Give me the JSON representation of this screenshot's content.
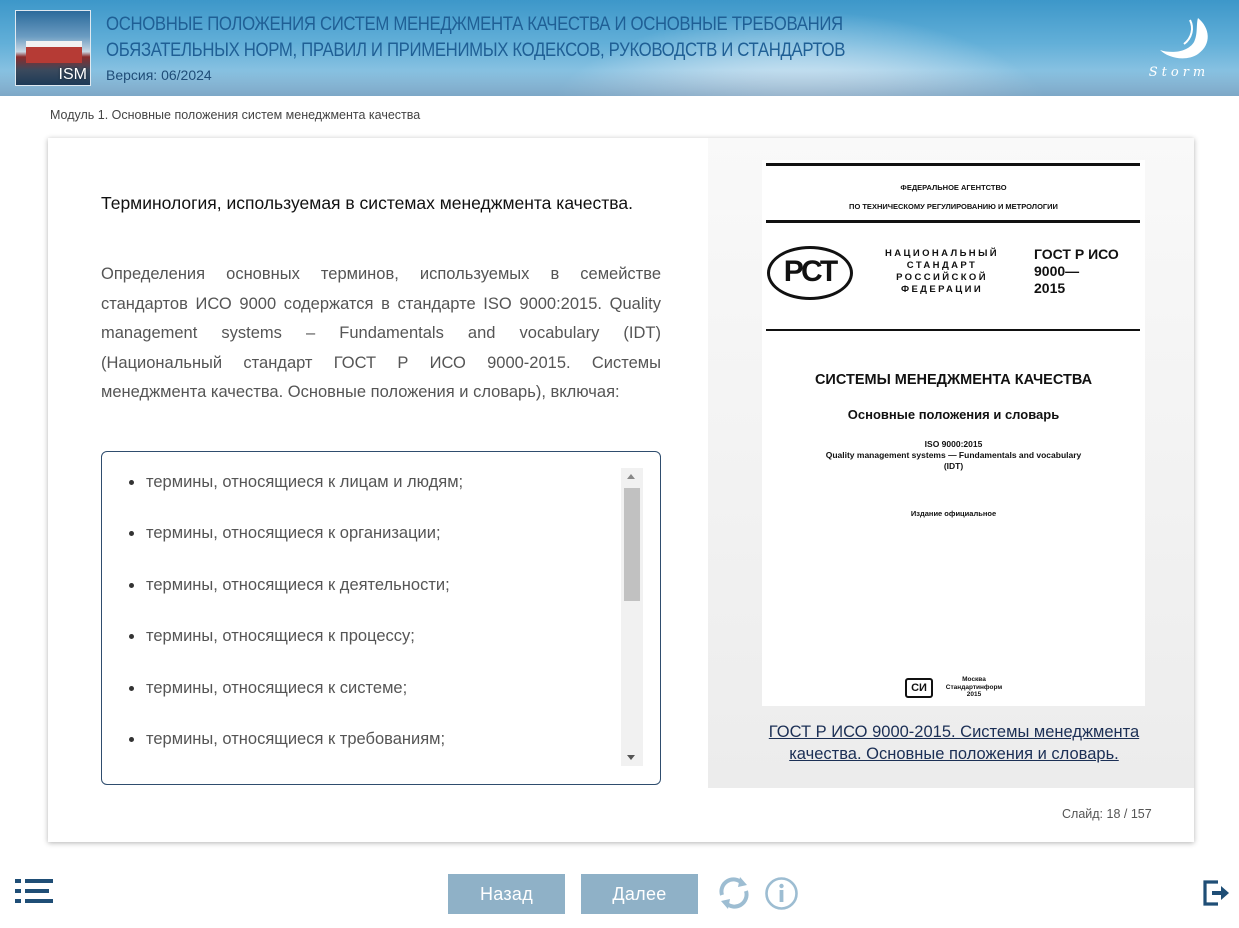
{
  "header": {
    "title_line1": "ОСНОВНЫЕ ПОЛОЖЕНИЯ СИСТЕМ МЕНЕДЖМЕНТА КАЧЕСТВА И ОСНОВНЫЕ ТРЕБОВАНИЯ",
    "title_line2": "ОБЯЗАТЕЛЬНЫХ НОРМ, ПРАВИЛ И ПРИМЕНИМЫХ КОДЕКСОВ, РУКОВОДСТВ И СТАНДАРТОВ",
    "version": "Версия: 06/2024",
    "logo_text": "ISM",
    "brand": "Storm"
  },
  "breadcrumb": "Модуль 1. Основные положения систем менеджмента качества",
  "content": {
    "heading": "Терминология, используемая в системах менеджмента качества.",
    "body": "Определения основных терминов, используемых в семействе стандартов ИСО 9000 содержатся в стандарте ISO 9000:2015. Quality management systems – Fundamentals and vocabulary (IDT) (Национальный стандарт ГОСТ Р ИСО 9000-2015. Системы менеджмента качества. Основные положения и словарь), включая:",
    "list": [
      "термины, относящиеся к лицам и людям;",
      "термины, относящиеся к организации;",
      "термины, относящиеся к деятельности;",
      "термины, относящиеся к процессу;",
      "термины, относящиеся к системе;",
      "термины, относящиеся к требованиям;"
    ]
  },
  "document": {
    "agency_line1": "ФЕДЕРАЛЬНОЕ АГЕНТСТВО",
    "agency_line2": "ПО ТЕХНИЧЕСКОМУ РЕГУЛИРОВАНИЮ И МЕТРОЛОГИИ",
    "logo_text": "РСТ",
    "national_standard": "НАЦИОНАЛЬНЫЙ СТАНДАРТ РОССИЙСКОЙ ФЕДЕРАЦИИ",
    "number_line1": "ГОСТ Р ИСО",
    "number_line2": "9000—",
    "number_line3": "2015",
    "title": "СИСТЕМЫ МЕНЕДЖМЕНТА КАЧЕСТВА",
    "subtitle": "Основные положения и словарь",
    "iso_line1": "ISO 9000:2015",
    "iso_line2": "Quality management systems — Fundamentals and vocabulary",
    "iso_line3": "(IDT)",
    "official": "Издание официальное",
    "publisher_mark": "СИ",
    "publisher_line1": "Москва",
    "publisher_line2": "Стандартинформ",
    "publisher_line3": "2015"
  },
  "caption_link": "ГОСТ Р ИСО 9000-2015. Системы менеджмента качества. Основные положения и словарь.",
  "slide_counter": "Слайд:  18 / 157",
  "nav": {
    "back": "Назад",
    "next": "Далее"
  },
  "colors": {
    "header_title": "#1f5f95",
    "nav_button": "#8fb1c7",
    "icon": "#1f4e76"
  },
  "icons": [
    "menu-icon",
    "refresh-icon",
    "info-icon",
    "exit-icon"
  ],
  "list_scroll_fraction": 0
}
